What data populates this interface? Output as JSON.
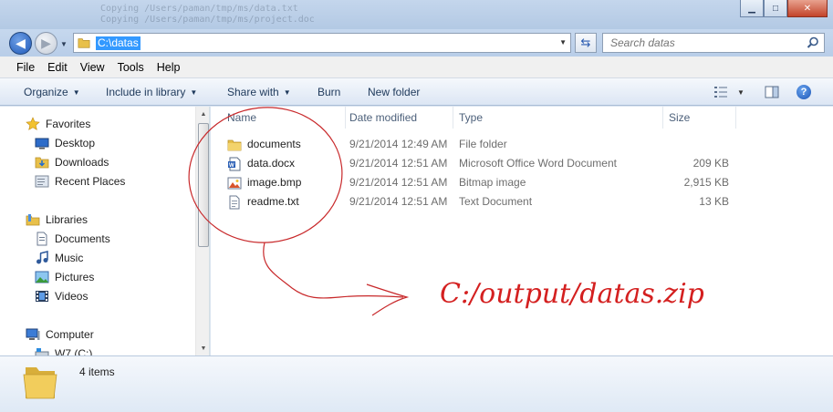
{
  "titlebar": {
    "ghost_lines": [
      "Copying /Users/paman/tmp/ms/data.txt",
      "Copying /Users/paman/tmp/ms/project.doc"
    ],
    "minimize": "▁",
    "maximize": "□",
    "close": "✕"
  },
  "address": {
    "path": "C:\\datas",
    "search_placeholder": "Search datas"
  },
  "menu": {
    "file": "File",
    "edit": "Edit",
    "view": "View",
    "tools": "Tools",
    "help": "Help"
  },
  "commands": {
    "organize": "Organize",
    "include_in_library": "Include in library",
    "share_with": "Share with",
    "burn": "Burn",
    "new_folder": "New folder"
  },
  "navigation": {
    "favorites": "Favorites",
    "desktop": "Desktop",
    "downloads": "Downloads",
    "recent_places": "Recent Places",
    "libraries": "Libraries",
    "documents": "Documents",
    "music": "Music",
    "pictures": "Pictures",
    "videos": "Videos",
    "computer": "Computer",
    "w7": "W7 (C:)"
  },
  "columns": {
    "name": "Name",
    "date_modified": "Date modified",
    "type": "Type",
    "size": "Size"
  },
  "files": [
    {
      "name": "documents",
      "date": "9/21/2014 12:49 AM",
      "type": "File folder",
      "size": "",
      "icon": "folder-icon"
    },
    {
      "name": "data.docx",
      "date": "9/21/2014 12:51 AM",
      "type": "Microsoft Office Word Document",
      "size": "209 KB",
      "icon": "word-document-icon"
    },
    {
      "name": "image.bmp",
      "date": "9/21/2014 12:51 AM",
      "type": "Bitmap image",
      "size": "2,915 KB",
      "icon": "bitmap-image-icon"
    },
    {
      "name": "readme.txt",
      "date": "9/21/2014 12:51 AM",
      "type": "Text Document",
      "size": "13 KB",
      "icon": "text-file-icon"
    }
  ],
  "annotation": {
    "text": "C:/output/datas.zip",
    "color": "#d42020"
  },
  "details": {
    "count": "4 items"
  }
}
